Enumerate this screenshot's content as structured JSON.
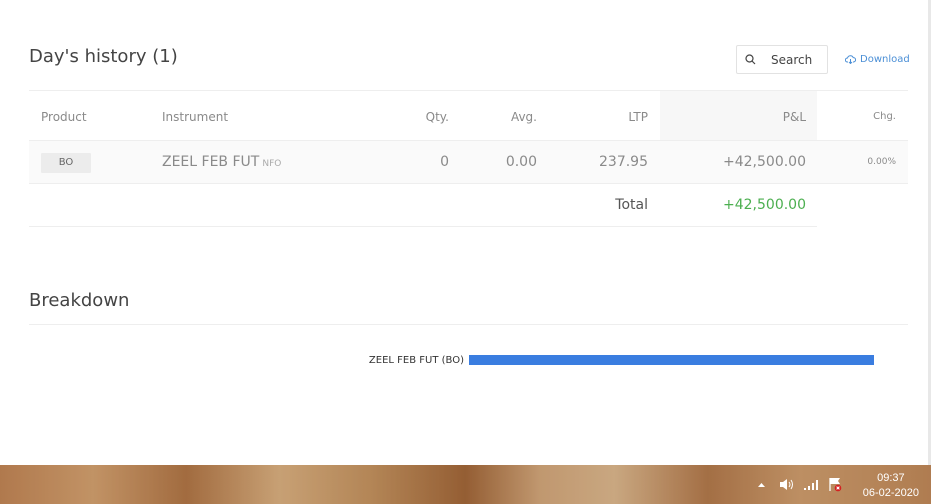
{
  "header": {
    "title": "Day's history (1)",
    "search_placeholder": "Search",
    "download_label": "Download"
  },
  "table": {
    "columns": [
      "Product",
      "Instrument",
      "Qty.",
      "Avg.",
      "LTP",
      "P&L",
      "Chg."
    ],
    "rows": [
      {
        "product": "BO",
        "instrument": "ZEEL FEB FUT",
        "exchange": "NFO",
        "qty": "0",
        "avg": "0.00",
        "ltp": "237.95",
        "pnl": "+42,500.00",
        "chg": "0.00%"
      }
    ],
    "total_label": "Total",
    "total_value": "+42,500.00"
  },
  "breakdown": {
    "title": "Breakdown",
    "items": [
      {
        "label": "ZEEL FEB FUT (BO)",
        "value": 42500
      }
    ],
    "max": 42500,
    "bar_color": "#3a7de0"
  },
  "taskbar": {
    "time": "09:37",
    "date": "06-02-2020",
    "icons": [
      "chevron-up-icon",
      "volume-icon",
      "network-signal-icon",
      "action-center-flag-icon"
    ]
  }
}
